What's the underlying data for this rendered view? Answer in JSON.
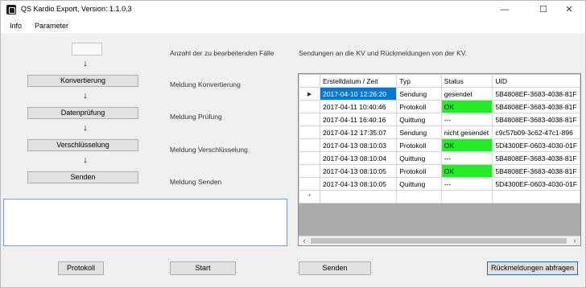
{
  "window": {
    "title": "QS Kardio Export, Version: 1.1.0.3",
    "controls": {
      "minimize": "—",
      "maximize": "☐",
      "close": "✕"
    }
  },
  "menu": [
    "Info",
    "Parameter"
  ],
  "flow": {
    "count_value": "",
    "steps": [
      "Konvertierung",
      "Datenprüfung",
      "Verschlüsselung",
      "Senden"
    ],
    "arrow": "↓"
  },
  "labels": {
    "count": "Anzahl der zu bearbeitenden Fälle",
    "msg_convert": "Meldung Konvertierung",
    "msg_check": "Meldung Prüfung",
    "msg_encrypt": "Meldung Verschlüsselung",
    "msg_send": "Meldung Senden",
    "grid_title": "Sendungen an die KV und Rückmeldungen von der KV."
  },
  "grid": {
    "columns": [
      "Erstelldatum / Zeit",
      "Typ",
      "Status",
      "UID"
    ],
    "rows": [
      {
        "marker": "▶",
        "datetime": "2017-04-10 12:26:20",
        "type": "Sendung",
        "status": "gesendet",
        "uid": "5B4808EF-3683-4038-81F",
        "selected": true,
        "ok": false
      },
      {
        "marker": "",
        "datetime": "2017-04-11 10:40:46",
        "type": "Protokoll",
        "status": "OK",
        "uid": "5B4808EF-3683-4038-81F",
        "selected": false,
        "ok": true
      },
      {
        "marker": "",
        "datetime": "2017-04-11 16:40:16",
        "type": "Quittung",
        "status": "---",
        "uid": "5B4808EF-3683-4038-81F",
        "selected": false,
        "ok": false
      },
      {
        "marker": "",
        "datetime": "2017-04-12 17:35:07",
        "type": "Sendung",
        "status": "nicht gesendet",
        "uid": "c9c57b09-3c62-47c1-896",
        "selected": false,
        "ok": false
      },
      {
        "marker": "",
        "datetime": "2017-04-13 08:10:03",
        "type": "Protokoll",
        "status": "OK",
        "uid": "5D4300EF-0603-4030-01F",
        "selected": false,
        "ok": true
      },
      {
        "marker": "",
        "datetime": "2017-04-13 08:10:04",
        "type": "Quittung",
        "status": "---",
        "uid": "5B4808EF-3683-4038-81F",
        "selected": false,
        "ok": false
      },
      {
        "marker": "",
        "datetime": "2017-04-13 08:10:05",
        "type": "Protokoll",
        "status": "OK",
        "uid": "5B4808EF-3683-4038-81F",
        "selected": false,
        "ok": true
      },
      {
        "marker": "",
        "datetime": "2017-04-13 08:10:05",
        "type": "Quittung",
        "status": "---",
        "uid": "5D4300EF-0603-4030-01F",
        "selected": false,
        "ok": false
      },
      {
        "marker": "*",
        "datetime": "",
        "type": "",
        "status": "",
        "uid": "",
        "selected": false,
        "ok": false
      }
    ]
  },
  "buttons": {
    "protocol": "Protokoll",
    "start": "Start",
    "send": "Senden",
    "fetch": "Rückmeldungen abfragen"
  },
  "colors": {
    "selection": "#0078d7",
    "status_ok": "#22ef22"
  }
}
